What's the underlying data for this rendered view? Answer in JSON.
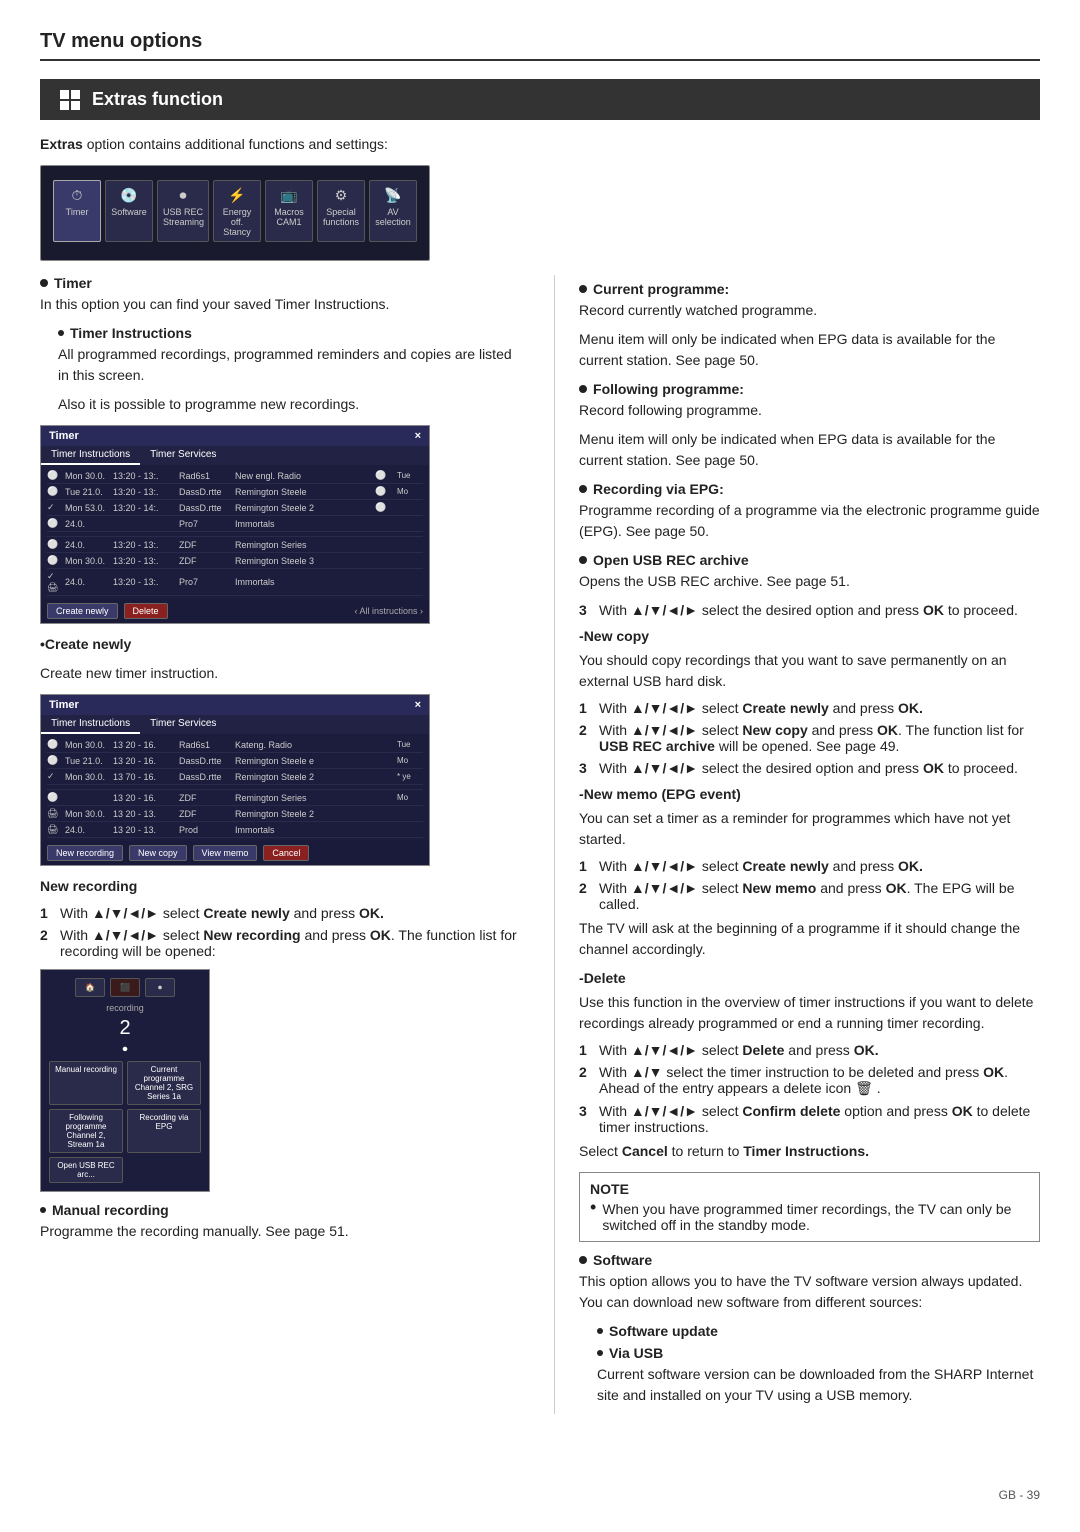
{
  "page": {
    "title": "TV menu options",
    "page_number": "GB  -  39"
  },
  "extras_header": {
    "label": "Extras function"
  },
  "intro": {
    "text": "Extras option contains additional functions and settings:"
  },
  "left_col": {
    "timer_section": {
      "bullet_label": "Timer",
      "bullet_text": "In this option you can find your saved Timer Instructions."
    },
    "timer_instructions": {
      "label": "Timer Instructions",
      "text1": "All programmed recordings, programmed reminders and copies are listed in this screen.",
      "text2": "Also it is possible to programme new recordings."
    },
    "dialog": {
      "title": "Timer",
      "close": "×",
      "tabs": [
        "Timer Instructions",
        "Timer Services"
      ],
      "rows": [
        {
          "check": "",
          "day": "Mon 30.0.",
          "time": "13:20 - 13:.",
          "chan": "Rad6s1",
          "prog": "New engl. Radio",
          "icon": "",
          "extra": "Tue"
        },
        {
          "check": "",
          "day": "Tue 21.0.",
          "time": "13:20 - 13:.",
          "chan": "DassD.rtte",
          "prog": "Remington Steele",
          "icon": "",
          "extra": "Mo"
        },
        {
          "check": "✓",
          "day": "Mon 53.0.",
          "time": "13:20 - 14:.",
          "chan": "DassD.rtte",
          "prog": "Remington Steele 2",
          "icon": "",
          "extra": ""
        },
        {
          "check": "",
          "day": "24.0.",
          "time": "",
          "chan": "Pro7",
          "prog": "Immortals",
          "icon": "",
          "extra": ""
        },
        {
          "check": "",
          "day": "",
          "time": "",
          "chan": "",
          "prog": "",
          "icon": "",
          "extra": ""
        },
        {
          "check": "",
          "day": "24.0.",
          "time": "13:20 - 13:.",
          "chan": "ZDF",
          "prog": "Remington Series",
          "icon": "",
          "extra": ""
        },
        {
          "check": "",
          "day": "Mon 30.0.",
          "time": "13:20 - 13:.",
          "chan": "ZDF",
          "prog": "Remington Steele 3",
          "icon": "",
          "extra": ""
        },
        {
          "check": "✓ 🖨",
          "day": "24.0.",
          "time": "13:20 - 13:.",
          "chan": "Pro7",
          "prog": "Immortals",
          "icon": "",
          "extra": ""
        }
      ],
      "buttons": [
        "Create newly",
        "Delete"
      ],
      "nav": "All instructions"
    },
    "create_newly": {
      "label": "•Create newly",
      "text": "Create new timer instruction."
    },
    "dialog2": {
      "title": "Timer",
      "close": "×",
      "tabs": [
        "Timer Instructions",
        "Timer Services"
      ],
      "rows": [
        {
          "day": "Mon 30.0.",
          "time": "13 20 - 16.",
          "chan": "Rad6s1",
          "prog": "Kateng. Radio",
          "extra": "Tue"
        },
        {
          "day": "Tue 21.0.",
          "time": "13 20 - 16.",
          "chan": "DassD.rtte",
          "prog": "Remington Steele e",
          "extra": "Mo"
        },
        {
          "day": "✓ Mon 30.0.",
          "time": "13 70 - 16.",
          "chan": "DassD.rtte",
          "prog": "Remington Steele 2",
          "extra": "* ye"
        },
        {
          "day": "",
          "time": "",
          "chan": "",
          "prog": "",
          "extra": ""
        },
        {
          "day": "",
          "time": "13 20 - 16.",
          "chan": "ZDF",
          "prog": "Remington Series",
          "extra": "Mo"
        },
        {
          "day": "🖨 Mon 30.0.",
          "time": "13 20 - 13.",
          "chan": "ZDF",
          "prog": "Remington Steele 2",
          "extra": ""
        },
        {
          "day": "🖨 24.0.",
          "time": "13 20 - 13.",
          "chan": "Prod",
          "prog": "Immortals",
          "extra": ""
        }
      ],
      "buttons": [
        "New recording",
        "New copy",
        "View memo",
        "Cancel"
      ]
    },
    "new_recording": {
      "label": "New recording"
    },
    "step1": {
      "num": "1",
      "text_prefix": "With ",
      "arrows": "▲/▼/◄/►",
      "text_bold": " select Create newly",
      "text_suffix": " and press "
    },
    "step1_ok": "OK.",
    "step2": {
      "num": "2",
      "text_prefix": "With ",
      "arrows": "▲/▼/◄/►",
      "text_bold": " select New recording",
      "text_suffix": " and"
    },
    "step2_line2": "press OK. The function list for recording will be opened:",
    "func_dialog": {
      "icons": [
        "🏠",
        "⬛",
        "⏺"
      ],
      "label": "recording",
      "num": "2",
      "options": [
        "Manual recording",
        "Current programme Channel 2, SRG Series 1a",
        "Following programme Channel 2, Stream 1a",
        "Recording via EPG",
        "Open USB REC arc..."
      ]
    },
    "manual_recording": {
      "label": "Manual recording",
      "text": "Programme the recording manually. See page 51."
    }
  },
  "right_col": {
    "current_programme": {
      "label": "Current programme:",
      "text1": "Record currently watched programme.",
      "text2": "Menu item will only be indicated when EPG data is available for the current station. See page 50."
    },
    "following_programme": {
      "label": "Following programme:",
      "text1": "Record following programme.",
      "text2": "Menu item will only be indicated when EPG data is available for the current station. See page 50."
    },
    "recording_via_epg": {
      "label": "Recording via EPG:",
      "text": "Programme recording of a programme via the electronic programme guide (EPG). See page 50."
    },
    "open_usb": {
      "label": "Open USB REC archive",
      "text": "Opens the USB REC archive. See page 51."
    },
    "step3": {
      "num": "3",
      "text": "With ▲/▼/◄/► select the desired option and press OK to proceed."
    },
    "new_copy": {
      "label": "-New copy",
      "text": "You should copy recordings that you want to save permanently on an external USB hard disk."
    },
    "nc_step1": {
      "num": "1",
      "text": "With ▲/▼/◄/► select Create newly and press OK."
    },
    "nc_step2": {
      "num": "2",
      "text": "With ▲/▼/◄/► select New copy and press OK. The function list for USB REC archive will be opened. See page 49."
    },
    "nc_step3": {
      "num": "3",
      "text": "With ▲/▼/◄/► select the desired option and press OK to proceed."
    },
    "new_memo": {
      "label": "-New memo (EPG event)",
      "text": "You can set a timer as a reminder for programmes which have not yet  started."
    },
    "nm_step1": {
      "num": "1",
      "text": "With ▲/▼/◄/► select Create newly and press OK."
    },
    "nm_step2": {
      "num": "2",
      "text": "With ▲/▼/◄/► select New memo and press OK. The EPG will be called."
    },
    "nm_note": "The TV will ask at the beginning of a programme if it should change the channel accordingly.",
    "delete_section": {
      "label": "-Delete",
      "text": "Use this function in the overview of timer instructions if you want to delete recordings already programmed or end a running timer recording."
    },
    "del_step1": {
      "num": "1",
      "text": "With ▲/▼/◄/► select Delete and press OK."
    },
    "del_step2": {
      "num": "2",
      "text": "With ▲/▼ select the timer instruction to be deleted and press OK. Ahead of the entry appears a delete icon 🗑 ."
    },
    "del_step3": {
      "num": "3",
      "text": "With ▲/▼/◄/► select Confirm delete option and press OK to delete timer instructions."
    },
    "select_cancel": "Select Cancel to return to Timer Instructions.",
    "note": {
      "title": "NOTE",
      "bullet": "When you have programmed timer recordings, the TV can only be switched off in the standby mode."
    },
    "software": {
      "label": "Software",
      "text": "This option allows you to have the TV software version always updated. You can download new software from different sources:"
    },
    "software_update": {
      "label": "Software update"
    },
    "via_usb": {
      "label": "Via USB"
    },
    "via_usb_text": "Current software version can be downloaded from the SHARP Internet site and installed on your TV using a USB memory."
  }
}
